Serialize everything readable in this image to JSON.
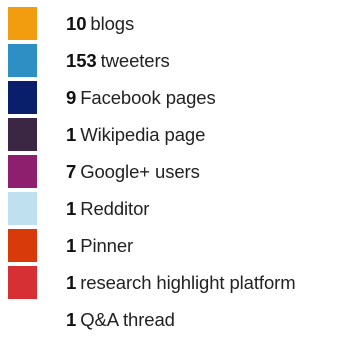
{
  "legend": {
    "items": [
      {
        "count": "10",
        "label": "blogs",
        "color": "#f29c0f"
      },
      {
        "count": "153",
        "label": "tweeters",
        "color": "#2d8fc4"
      },
      {
        "count": "9",
        "label": "Facebook pages",
        "color": "#0a1f6b"
      },
      {
        "count": "1",
        "label": "Wikipedia page",
        "color": "#3b2644"
      },
      {
        "count": "7",
        "label": "Google+ users",
        "color": "#8e1f6f"
      },
      {
        "count": "1",
        "label": "Redditor",
        "color": "#bfe0ee"
      },
      {
        "count": "1",
        "label": "Pinner",
        "color": "#d93a0a"
      },
      {
        "count": "1",
        "label": "research highlight platform",
        "color": "#d63034"
      },
      {
        "count": "1",
        "label": "Q&A thread",
        "color": "#ffffff"
      }
    ]
  }
}
